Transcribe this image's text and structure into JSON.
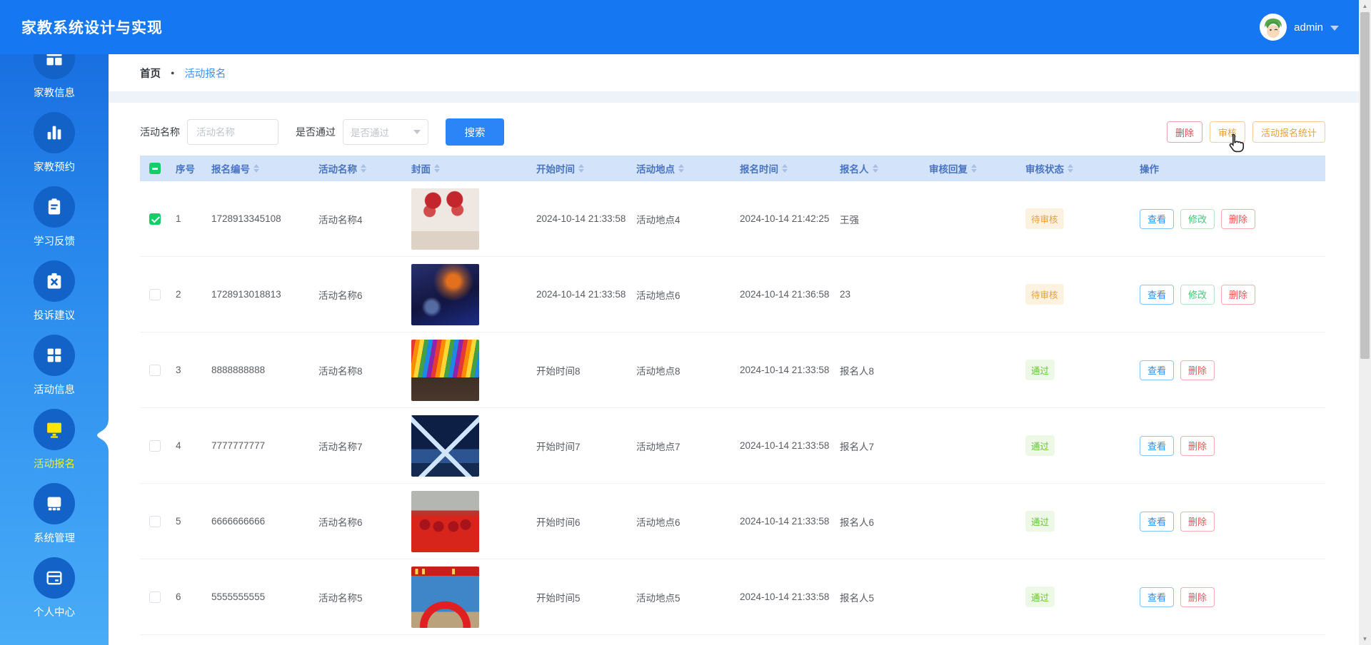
{
  "header": {
    "title": "家教系统设计与实现",
    "user": "admin"
  },
  "sidebar": {
    "items": [
      {
        "id": "tutor-info",
        "label": "家教信息",
        "icon": "grid-icon",
        "active": false
      },
      {
        "id": "tutor-booking",
        "label": "家教预约",
        "icon": "bar-chart-icon",
        "active": false
      },
      {
        "id": "study-feedback",
        "label": "学习反馈",
        "icon": "clipboard-icon",
        "active": false
      },
      {
        "id": "complaints",
        "label": "投诉建议",
        "icon": "suggestion-box-icon",
        "active": false
      },
      {
        "id": "activity-info",
        "label": "活动信息",
        "icon": "four-squares-icon",
        "active": false
      },
      {
        "id": "activity-signup",
        "label": "活动报名",
        "icon": "monitor-icon",
        "active": true
      },
      {
        "id": "system-mgmt",
        "label": "系统管理",
        "icon": "storefront-icon",
        "active": false
      },
      {
        "id": "personal-center",
        "label": "个人中心",
        "icon": "id-card-icon",
        "active": false
      }
    ]
  },
  "breadcrumb": {
    "home": "首页",
    "current": "活动报名"
  },
  "filters": {
    "name_label": "活动名称",
    "name_placeholder": "活动名称",
    "pass_label": "是否通过",
    "pass_placeholder": "是否通过",
    "search_label": "搜索"
  },
  "toolbar": {
    "delete_label": "删除",
    "audit_label": "审核",
    "stats_label": "活动报名统计"
  },
  "table": {
    "columns": [
      {
        "key": "idx",
        "label": "序号",
        "sortable": false
      },
      {
        "key": "code",
        "label": "报名编号",
        "sortable": true
      },
      {
        "key": "name",
        "label": "活动名称",
        "sortable": true
      },
      {
        "key": "cover",
        "label": "封面",
        "sortable": true
      },
      {
        "key": "start",
        "label": "开始时间",
        "sortable": true
      },
      {
        "key": "place",
        "label": "活动地点",
        "sortable": true
      },
      {
        "key": "time",
        "label": "报名时间",
        "sortable": true
      },
      {
        "key": "person",
        "label": "报名人",
        "sortable": true
      },
      {
        "key": "reply",
        "label": "审核回复",
        "sortable": true
      },
      {
        "key": "status",
        "label": "审核状态",
        "sortable": true
      },
      {
        "key": "op",
        "label": "操作",
        "sortable": false
      }
    ],
    "header_checkbox_state": "indeterminate",
    "rows": [
      {
        "checked": true,
        "index": "1",
        "code": "1728913345108",
        "name": "活动名称4",
        "cover": "heart-balloons",
        "start": "2024-10-14 21:33:58",
        "place": "活动地点4",
        "time": "2024-10-14 21:42:25",
        "person": "王强",
        "reply": "",
        "status": "待审核",
        "status_type": "pending",
        "actions": [
          {
            "label": "查看",
            "type": "view"
          },
          {
            "label": "修改",
            "type": "edit"
          },
          {
            "label": "删除",
            "type": "delete"
          }
        ]
      },
      {
        "checked": false,
        "index": "2",
        "code": "1728913018813",
        "name": "活动名称6",
        "cover": "blue-stage",
        "start": "2024-10-14 21:33:58",
        "place": "活动地点6",
        "time": "2024-10-14 21:36:58",
        "person": "23",
        "reply": "",
        "status": "待审核",
        "status_type": "pending",
        "actions": [
          {
            "label": "查看",
            "type": "view"
          },
          {
            "label": "修改",
            "type": "edit"
          },
          {
            "label": "删除",
            "type": "delete"
          }
        ]
      },
      {
        "checked": false,
        "index": "3",
        "code": "8888888888",
        "name": "活动名称8",
        "cover": "rainbow-stage",
        "start": "开始时间8",
        "place": "活动地点8",
        "time": "2024-10-14 21:33:58",
        "person": "报名人8",
        "reply": "",
        "status": "通过",
        "status_type": "passed",
        "actions": [
          {
            "label": "查看",
            "type": "view"
          },
          {
            "label": "删除",
            "type": "delete"
          }
        ]
      },
      {
        "checked": false,
        "index": "4",
        "code": "7777777777",
        "name": "活动名称7",
        "cover": "neon-tunnel",
        "start": "开始时间7",
        "place": "活动地点7",
        "time": "2024-10-14 21:33:58",
        "person": "报名人7",
        "reply": "",
        "status": "通过",
        "status_type": "passed",
        "actions": [
          {
            "label": "查看",
            "type": "view"
          },
          {
            "label": "删除",
            "type": "delete"
          }
        ]
      },
      {
        "checked": false,
        "index": "5",
        "code": "6666666666",
        "name": "活动名称6",
        "cover": "red-ceremony",
        "start": "开始时间6",
        "place": "活动地点6",
        "time": "2024-10-14 21:33:58",
        "person": "报名人6",
        "reply": "",
        "status": "通过",
        "status_type": "passed",
        "actions": [
          {
            "label": "查看",
            "type": "view"
          },
          {
            "label": "删除",
            "type": "delete"
          }
        ]
      },
      {
        "checked": false,
        "index": "6",
        "code": "5555555555",
        "name": "活动名称5",
        "cover": "red-arch",
        "start": "开始时间5",
        "place": "活动地点5",
        "time": "2024-10-14 21:33:58",
        "person": "报名人5",
        "reply": "",
        "status": "通过",
        "status_type": "passed",
        "actions": [
          {
            "label": "查看",
            "type": "view"
          },
          {
            "label": "删除",
            "type": "delete"
          }
        ]
      }
    ]
  },
  "colors": {
    "header_bg": "#1677f2",
    "sidebar_top": "#1569dd",
    "sidebar_bottom": "#49acf7",
    "active_icon": "#ffe600",
    "active_label": "#dff04f",
    "table_header_bg": "#d3e4fa",
    "table_header_text": "#4a74c0",
    "link": "#3e8ff6",
    "success": "#67c23a",
    "warning": "#e6a23c",
    "danger": "#f56c6c",
    "checkbox_checked": "#13ce66"
  }
}
